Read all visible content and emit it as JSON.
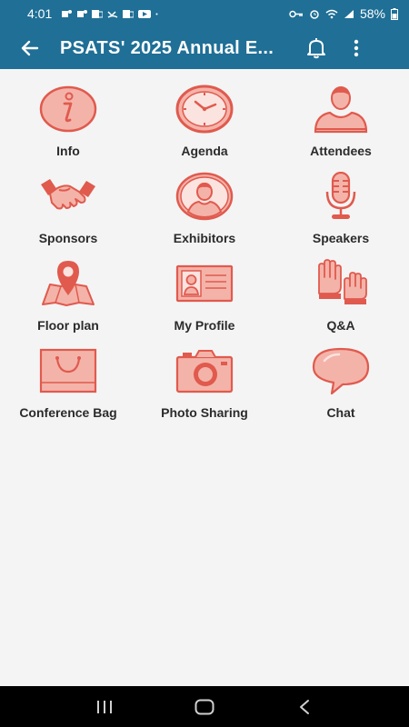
{
  "status_bar": {
    "time": "4:01",
    "battery": "58%",
    "notification_icons": [
      "teams-icon",
      "teams-icon",
      "outlook-icon",
      "missed-call-icon",
      "outlook-icon",
      "youtube-icon",
      "dot-icon"
    ],
    "system_icons": [
      "key-icon",
      "alarm-icon",
      "wifi-icon",
      "signal-icon",
      "battery-icon"
    ]
  },
  "app_bar": {
    "title": "PSATS' 2025 Annual E...",
    "back_icon": "arrow-left-icon",
    "bell_icon": "bell-icon",
    "more_icon": "more-vertical-icon"
  },
  "menu": {
    "items": [
      {
        "label": "Info",
        "icon": "info-icon"
      },
      {
        "label": "Agenda",
        "icon": "clock-icon"
      },
      {
        "label": "Attendees",
        "icon": "person-icon"
      },
      {
        "label": "Sponsors",
        "icon": "handshake-icon"
      },
      {
        "label": "Exhibitors",
        "icon": "person-circle-icon"
      },
      {
        "label": "Speakers",
        "icon": "microphone-icon"
      },
      {
        "label": "Floor plan",
        "icon": "map-pin-icon"
      },
      {
        "label": "My Profile",
        "icon": "id-card-icon"
      },
      {
        "label": "Q&A",
        "icon": "raised-hands-icon"
      },
      {
        "label": "Conference Bag",
        "icon": "bag-icon"
      },
      {
        "label": "Photo Sharing",
        "icon": "camera-icon"
      },
      {
        "label": "Chat",
        "icon": "chat-bubble-icon"
      }
    ]
  },
  "colors": {
    "app_bar": "#1f6f96",
    "icon_stroke": "#e05a4e",
    "icon_fill": "#f4b3a9",
    "label_text": "#2b2b2b",
    "background": "#f4f4f4"
  },
  "nav_bar": {
    "recents_icon": "recents-icon",
    "home_icon": "home-icon",
    "back_icon": "nav-back-icon"
  }
}
